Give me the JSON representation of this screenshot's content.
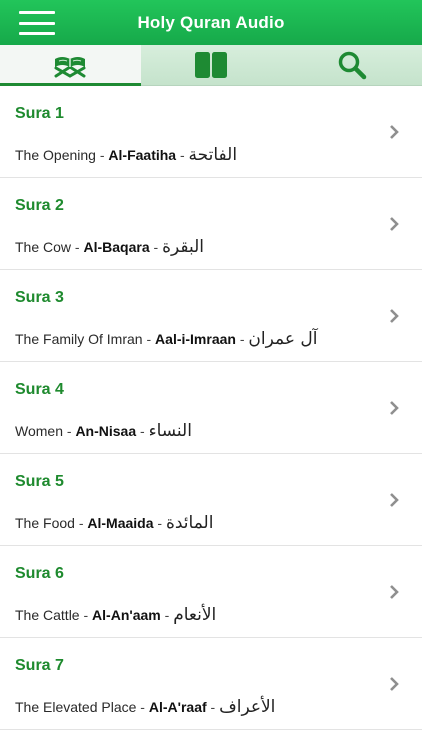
{
  "header": {
    "title": "Holy Quran Audio",
    "menu_icon": "hamburger-menu-icon",
    "color": "#1fb452"
  },
  "tabs": [
    {
      "icon": "quran-book-icon",
      "active": true
    },
    {
      "icon": "open-book-icon",
      "active": false
    },
    {
      "icon": "search-icon",
      "active": false
    }
  ],
  "suras": [
    {
      "title": "Sura 1",
      "english": "The Opening",
      "translit": "Al-Faatiha",
      "arabic": "الفاتحة"
    },
    {
      "title": "Sura 2",
      "english": "The Cow",
      "translit": "Al-Baqara",
      "arabic": "البقرة"
    },
    {
      "title": "Sura 3",
      "english": "The Family Of Imran",
      "translit": "Aal-i-Imraan",
      "arabic": "آل عمران"
    },
    {
      "title": "Sura 4",
      "english": "Women",
      "translit": "An-Nisaa",
      "arabic": "النساء"
    },
    {
      "title": "Sura 5",
      "english": "The Food",
      "translit": "Al-Maaida",
      "arabic": "المائدة"
    },
    {
      "title": "Sura 6",
      "english": "The Cattle",
      "translit": "Al-An'aam",
      "arabic": "الأنعام"
    },
    {
      "title": "Sura 7",
      "english": "The Elevated Place",
      "translit": "Al-A'raaf",
      "arabic": "الأعراف"
    }
  ],
  "separator": " - ",
  "colors": {
    "accent": "#1e8a2e",
    "tab_bg": "#cfe8d5",
    "chevron": "#8f8f8f"
  }
}
